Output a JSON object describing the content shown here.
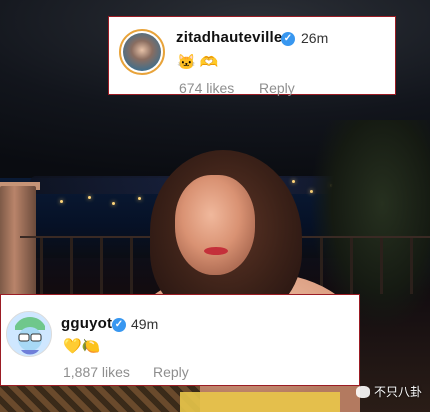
{
  "comments": [
    {
      "username": "zitadhauteville",
      "time": "26m",
      "emojis": "🐱 🫶",
      "likes": "674 likes",
      "reply": "Reply"
    },
    {
      "username": "gguyot",
      "time": "49m",
      "emojis": "💛🍋",
      "likes": "1,887 likes",
      "reply": "Reply"
    }
  ],
  "verified_mark": "✓",
  "watermark": "不只八卦",
  "colors": {
    "highlight_border": "#9b1c24",
    "verified_blue": "#3897f0",
    "meta_gray": "#8e8e8e"
  }
}
